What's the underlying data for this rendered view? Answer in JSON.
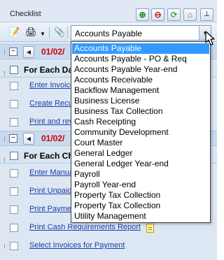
{
  "header": {
    "title": "Checklist"
  },
  "toolbar": {
    "combo_value": "Accounts Payable"
  },
  "dropdown": {
    "options": [
      "Accounts Payable",
      "Accounts Payable - PO & Req",
      "Accounts Payable Year-end",
      "Accounts Receivable",
      "Backflow Management",
      "Business License",
      "Business Tax Collection",
      "Cash Receipting",
      "Community Development",
      "Court Master",
      "General Ledger",
      "General Ledger Year-end",
      "Payroll",
      "Payroll Year-end",
      "Property Tax Collection",
      "Property Tax Collection",
      "Utility Management"
    ],
    "selected_index": 0
  },
  "groups": [
    {
      "date": "01/02/",
      "section_title": "For Each Day",
      "tasks": [
        "Enter Invoice",
        "Create Recu",
        "Print and rev"
      ]
    },
    {
      "date": "01/02/",
      "section_title": "For Each Che",
      "tasks": [
        "Enter Manual",
        "Print Unpaid",
        "Print Paymen",
        "Print Cash Requirements Report",
        "Select Invoices for Payment"
      ]
    }
  ],
  "colors": {
    "selection": "#3399ff",
    "date_red": "#cc0000",
    "link_blue": "#1a3ea8"
  }
}
